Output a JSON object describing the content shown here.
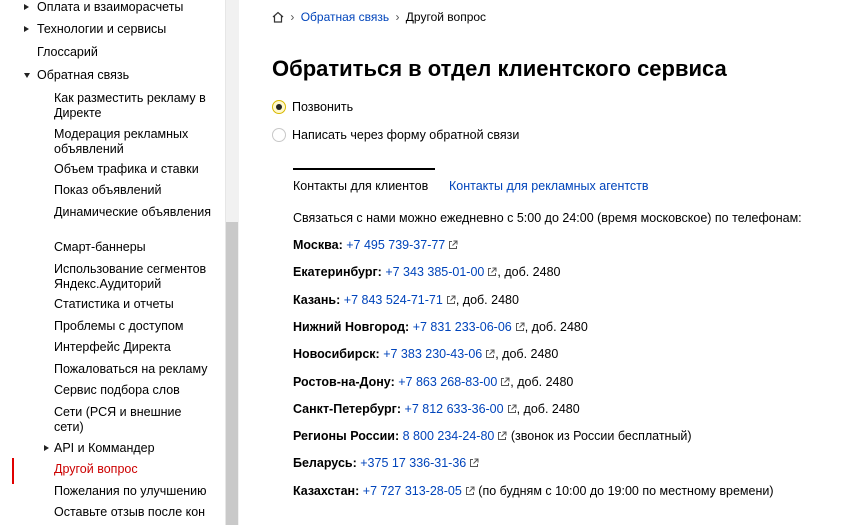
{
  "sidebar": {
    "items": [
      {
        "label": "Оплата и взаиморасчеты",
        "level": 1,
        "arrow": "right"
      },
      {
        "label": "Технологии и сервисы",
        "level": 1,
        "arrow": "right"
      },
      {
        "label": "Глоссарий",
        "level": 1,
        "arrow": ""
      },
      {
        "label": "Обратная связь",
        "level": 1,
        "arrow": "down"
      },
      {
        "label": "Как разместить рекламу в Директе",
        "level": 2,
        "arrow": ""
      },
      {
        "label": "Модерация рекламных объявлений",
        "level": 2,
        "arrow": ""
      },
      {
        "label": "Объем трафика и ставки",
        "level": 2,
        "arrow": ""
      },
      {
        "label": "Показ объявлений",
        "level": 2,
        "arrow": ""
      },
      {
        "label": "Динамические объявления",
        "level": 2,
        "arrow": ""
      },
      {
        "label": "Смарт-баннеры",
        "level": 2,
        "arrow": ""
      },
      {
        "label": "Использование сегментов Яндекс.Аудиторий",
        "level": 2,
        "arrow": ""
      },
      {
        "label": "Статистика и отчеты",
        "level": 2,
        "arrow": ""
      },
      {
        "label": "Проблемы с доступом",
        "level": 2,
        "arrow": ""
      },
      {
        "label": "Интерфейс Директа",
        "level": 2,
        "arrow": ""
      },
      {
        "label": "Пожаловаться на рекламу",
        "level": 2,
        "arrow": ""
      },
      {
        "label": "Сервис подбора слов",
        "level": 2,
        "arrow": ""
      },
      {
        "label": "Сети (РСЯ и внешние сети)",
        "level": 2,
        "arrow": ""
      },
      {
        "label": "API и Коммандер",
        "level": 2,
        "arrow": "right"
      },
      {
        "label": "Другой вопрос",
        "level": 2,
        "arrow": "",
        "selected": true
      },
      {
        "label": "Пожелания по улучшению",
        "level": 2,
        "arrow": ""
      },
      {
        "label": "Оставьте отзыв после кон",
        "level": 2,
        "arrow": ""
      }
    ]
  },
  "breadcrumb": {
    "home_icon": "home-icon",
    "sep": "›",
    "link": "Обратная связь",
    "current": "Другой вопрос"
  },
  "title": "Обратиться в отдел клиентского сервиса",
  "radios": {
    "call": "Позвонить",
    "form": "Написать через форму обратной связи"
  },
  "tabs": {
    "clients": "Контакты для клиентов",
    "agencies": "Контакты для рекламных агентств"
  },
  "intro": "Связаться с нами можно ежедневно с 5:00 до 24:00 (время московское) по телефонам:",
  "contacts": [
    {
      "city": "Москва:",
      "phone": "+7 495 739-37-77",
      "note": ""
    },
    {
      "city": "Екатеринбург:",
      "phone": "+7 343 385-01-00",
      "note": ", доб. 2480"
    },
    {
      "city": "Казань:",
      "phone": "+7 843 524-71-71",
      "note": ", доб. 2480"
    },
    {
      "city": "Нижний Новгород:",
      "phone": "+7 831 233-06-06",
      "note": ", доб. 2480"
    },
    {
      "city": "Новосибирск:",
      "phone": "+7 383 230-43-06",
      "note": ", доб. 2480"
    },
    {
      "city": "Ростов-на-Дону:",
      "phone": "+7 863 268-83-00",
      "note": ", доб. 2480"
    },
    {
      "city": "Санкт-Петербург:",
      "phone": "+7 812 633-36-00",
      "note": ", доб. 2480"
    },
    {
      "city": "Регионы России:",
      "phone": "8 800 234-24-80",
      "note": " (звонок из России бесплатный)"
    },
    {
      "city": "Беларусь:",
      "phone": "+375 17 336-31-36",
      "note": ""
    },
    {
      "city": "Казахстан:",
      "phone": "+7 727 313-28-05",
      "note": " (по будням с 10:00 до 19:00 по местному времени)"
    }
  ],
  "colors": {
    "link": "#0044bb",
    "selected": "#cc0000",
    "radio_accent": "#d8b800"
  }
}
